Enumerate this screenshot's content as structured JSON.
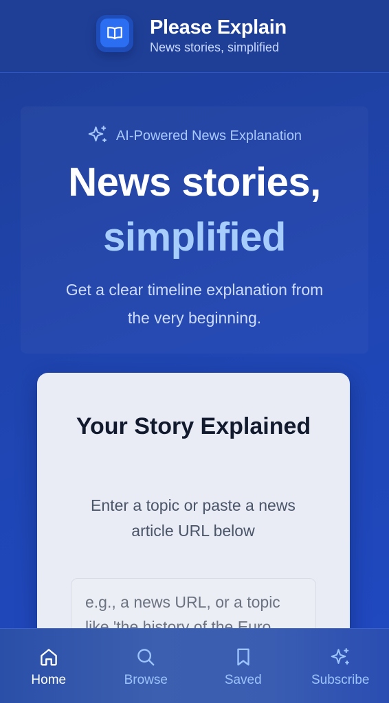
{
  "header": {
    "title": "Please Explain",
    "subtitle": "News stories, simplified",
    "logo_icon": "book-open-icon"
  },
  "hero": {
    "badge_icon": "sparkles-icon",
    "badge_text": "AI-Powered News Explanation",
    "headline_line1": "News stories,",
    "headline_line2": "simplified",
    "description": "Get a clear timeline explanation from the very beginning.",
    "accent_color": "#a6cdfc"
  },
  "card": {
    "title": "Your Story Explained",
    "description": "Enter a topic or paste a news article URL below",
    "input_placeholder": "e.g., a news URL, or a topic like 'the history of the Euro..."
  },
  "bottom_nav": {
    "items": [
      {
        "label": "Home",
        "icon": "home-icon",
        "active": true
      },
      {
        "label": "Browse",
        "icon": "search-icon",
        "active": false
      },
      {
        "label": "Saved",
        "icon": "bookmark-icon",
        "active": false
      },
      {
        "label": "Subscribe",
        "icon": "sparkles-icon",
        "active": false
      }
    ]
  }
}
